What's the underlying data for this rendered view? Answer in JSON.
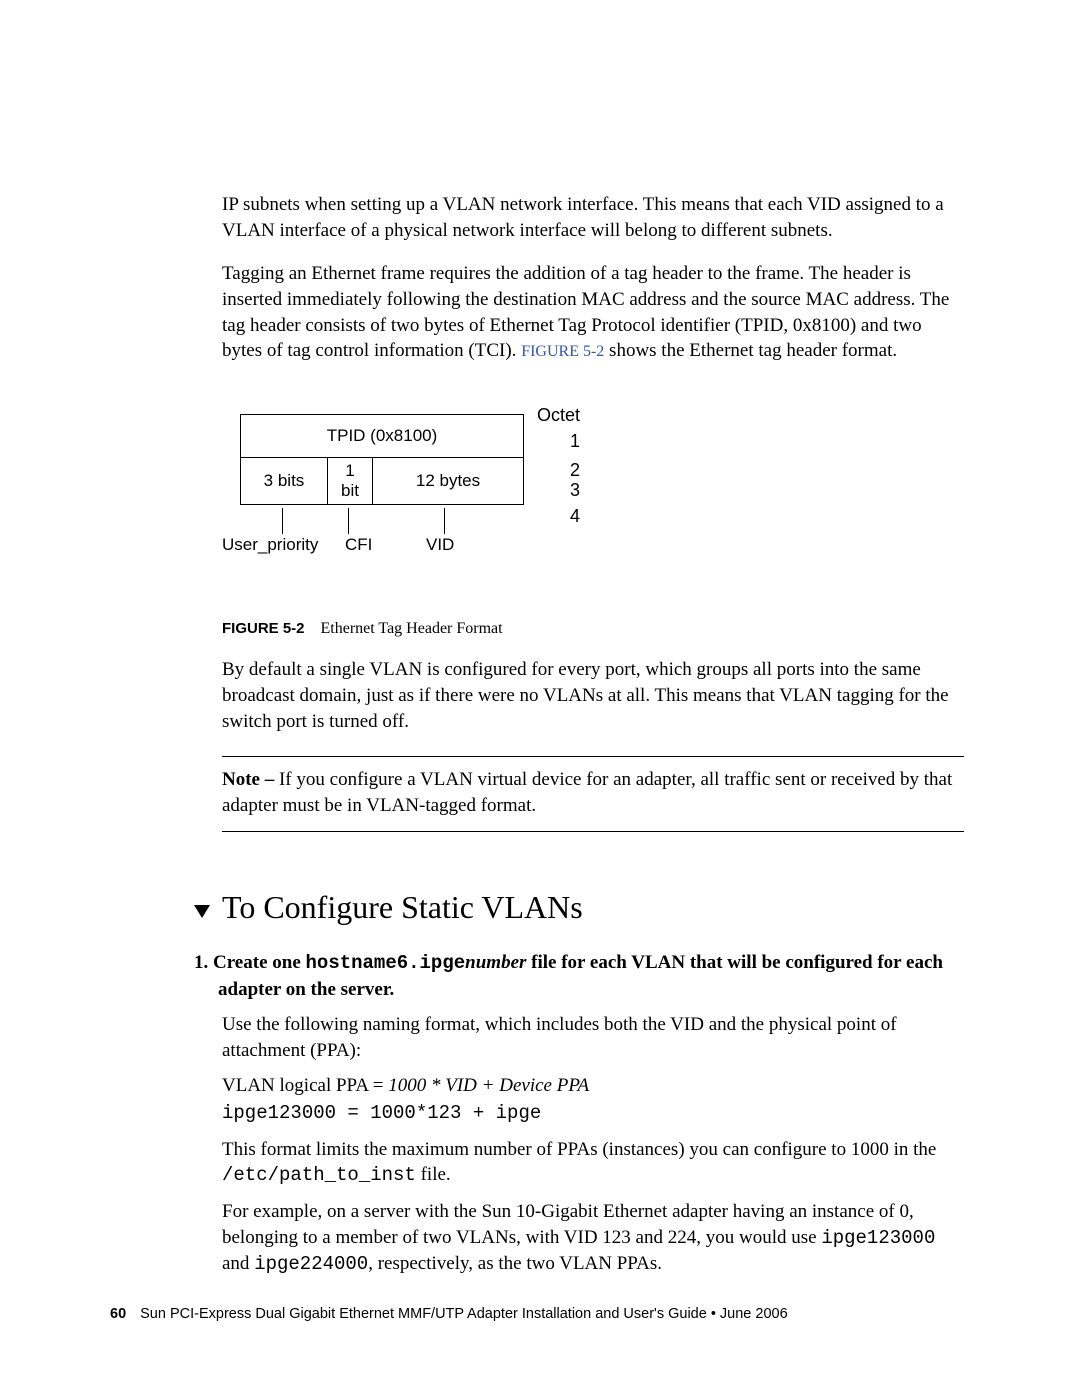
{
  "para1": "IP subnets when setting up a VLAN network interface. This means that each VID assigned to a VLAN interface of a physical network interface will belong to different subnets.",
  "para2_pre": "Tagging an Ethernet frame requires the addition of a tag header to the frame. The header is inserted immediately following the destination MAC address and the source MAC address. The tag header consists of two bytes of Ethernet Tag Protocol identifier (TPID, 0x8100) and two bytes of tag control information (TCI). ",
  "figref": "FIGURE 5-2",
  "para2_post": " shows the Ethernet tag header format.",
  "figure": {
    "octet_label": "Octet",
    "n1": "1",
    "n2_3": "2\n3",
    "n4": "4",
    "tpid": "TPID (0x8100)",
    "c3bits": "3 bits",
    "c1bit": "1\nbit",
    "c12b": "12 bytes",
    "user": "User_priority",
    "cfi": "CFI",
    "vid": "VID",
    "caption_key": "FIGURE 5-2",
    "caption_text": "Ethernet Tag Header Format"
  },
  "para3": "By default a single VLAN is configured for every port, which groups all ports into the same broadcast domain, just as if there were no VLANs at all. This means that VLAN tagging for the switch port is turned off.",
  "note_lead": "Note – ",
  "note_body": "If you configure a VLAN virtual device for an adapter, all traffic sent or received by that adapter must be in VLAN-tagged format.",
  "section_title": "To Configure Static VLANs",
  "step1": {
    "num": "1.",
    "lead": "Create one ",
    "code": "hostname6.ipge",
    "ital": "number",
    "rest": " file for each VLAN that will be configured for each adapter on the server."
  },
  "para_naming": "Use the following naming format, which includes both the VID and the physical point of attachment (PPA):",
  "formula_pre": "VLAN logical PPA = ",
  "formula_ital": "1000 * VID + Device PPA",
  "formula_code": "ipge123000 = 1000*123 + ipge",
  "para_limit_pre": "This format limits the maximum number of PPAs (instances) you can configure to 1000 in the ",
  "para_limit_code": "/etc/path_to_inst",
  "para_limit_post": " file.",
  "para_ex_pre": "For example, on a server with the Sun 10-Gigabit Ethernet adapter having an instance of 0, belonging to a member of two VLANs, with VID 123 and 224, you would use ",
  "para_ex_c1": "ipge123000",
  "para_ex_mid": " and ",
  "para_ex_c2": "ipge224000",
  "para_ex_post": ", respectively, as the two VLAN PPAs.",
  "footer": {
    "page": "60",
    "title": "Sun PCI-Express Dual Gigabit Ethernet MMF/UTP Adapter Installation and User's Guide  •  June 2006"
  }
}
